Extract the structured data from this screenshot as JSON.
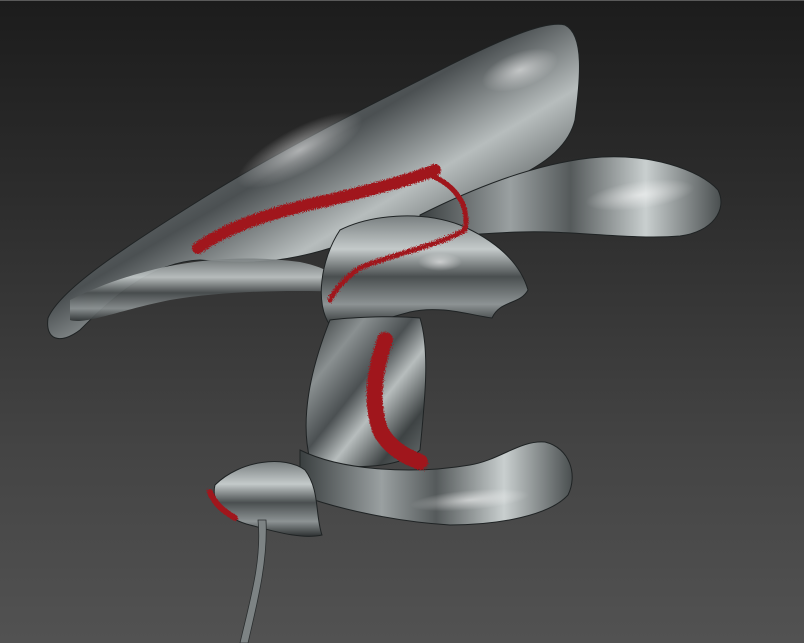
{
  "viewport": {
    "background_top": "#1c1c1c",
    "background_bottom": "#525252"
  },
  "model": {
    "surface_color": "#5b6062",
    "highlight_color": "#d9dede",
    "shadow_color": "#1e2122",
    "paint_stroke_color": "#a0141a"
  }
}
